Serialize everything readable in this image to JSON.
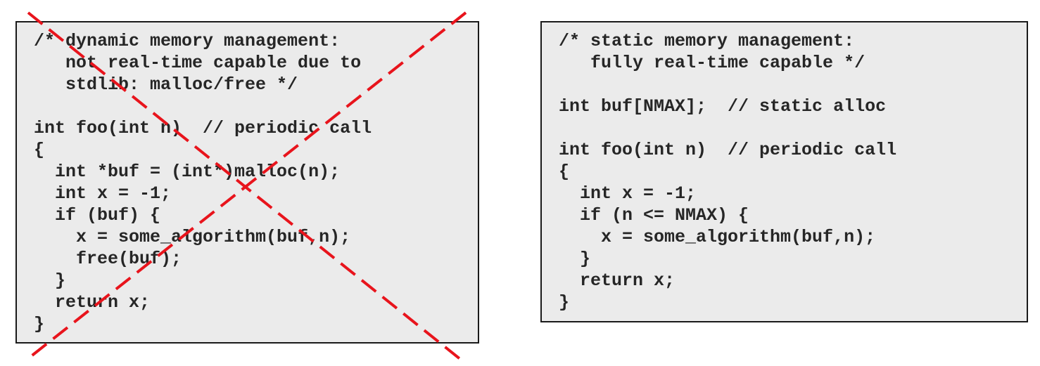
{
  "dynamic_example": {
    "lines": [
      "/* dynamic memory management:",
      "   not real-time capable due to",
      "   stdlib: malloc/free */",
      "",
      "int foo(int n)  // periodic call",
      "{",
      "  int *buf = (int*)malloc(n);",
      "  int x = -1;",
      "  if (buf) {",
      "    x = some_algorithm(buf,n);",
      "    free(buf);",
      "  }",
      "  return x;",
      "}"
    ],
    "strike_color": "#e8141c"
  },
  "static_example": {
    "lines": [
      "/* static memory management:",
      "   fully real-time capable */",
      "",
      "int buf[NMAX];  // static alloc",
      "",
      "int foo(int n)  // periodic call",
      "{",
      "  int x = -1;",
      "  if (n <= NMAX) {",
      "    x = some_algorithm(buf,n);",
      "  }",
      "  return x;",
      "}"
    ]
  },
  "colors": {
    "box_background": "#ebebeb",
    "box_border": "#1a1a1a",
    "code_text": "#262626"
  }
}
